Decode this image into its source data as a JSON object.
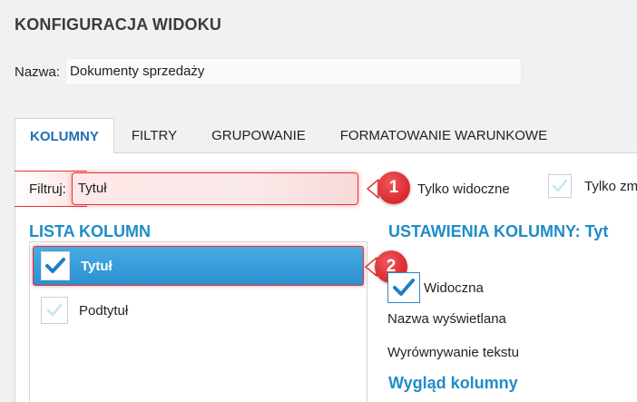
{
  "window": {
    "title": "KONFIGURACJA WIDOKU"
  },
  "name": {
    "label": "Nazwa:",
    "value": "Dokumenty sprzedaży"
  },
  "tabs": [
    {
      "label": "KOLUMNY",
      "active": true
    },
    {
      "label": "FILTRY",
      "active": false
    },
    {
      "label": "GRUPOWANIE",
      "active": false
    },
    {
      "label": "FORMATOWANIE WARUNKOWE",
      "active": false
    }
  ],
  "filter": {
    "label": "Filtruj:",
    "value": "Tytuł"
  },
  "options": {
    "only_visible": {
      "label": "Tylko widoczne",
      "checked": false
    },
    "only_changed": {
      "label": "Tylko zm",
      "checked": false
    }
  },
  "column_list": {
    "title": "LISTA KOLUMN",
    "items": [
      {
        "label": "Tytuł",
        "checked": true,
        "selected": true
      },
      {
        "label": "Podtytuł",
        "checked": false,
        "selected": false
      }
    ]
  },
  "column_settings": {
    "title": "USTAWIENIA KOLUMNY: Tyt",
    "visible_label": "Widoczna",
    "visible_checked": true,
    "display_name_label": "Nazwa wyświetlana",
    "text_align_label": "Wyrównywanie tekstu",
    "appearance_title": "Wygląd kolumny"
  },
  "callouts": [
    {
      "number": "1"
    },
    {
      "number": "2"
    }
  ],
  "colors": {
    "accent": "#1f8cc8",
    "tab_active": "#1f6fb5",
    "selection": "#2c8fcf",
    "highlight": "#e8353a"
  }
}
